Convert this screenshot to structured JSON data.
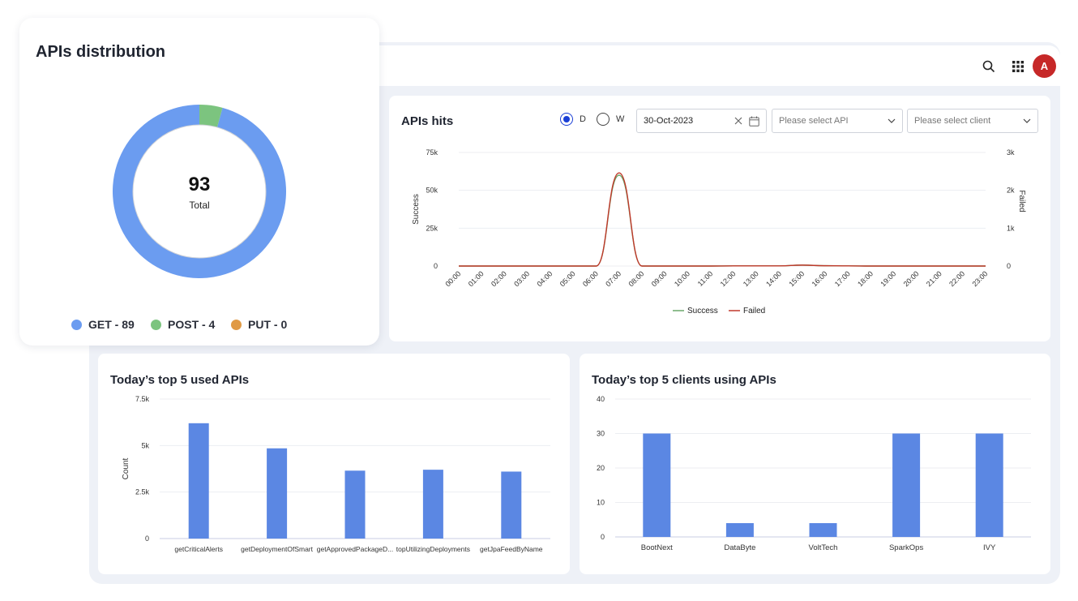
{
  "header": {
    "search_icon": "search-icon",
    "apps_icon": "apps-grid-icon",
    "avatar_initial": "A"
  },
  "distribution": {
    "title": "APIs distribution",
    "total_value": "93",
    "total_label": "Total",
    "legend": [
      {
        "label": "GET - 89",
        "color": "#6b9cf0"
      },
      {
        "label": "POST - 4",
        "color": "#7cc47f"
      },
      {
        "label": "PUT - 0",
        "color": "#e09a45"
      }
    ]
  },
  "hits": {
    "title": "APIs hits",
    "radio_d": "D",
    "radio_w": "W",
    "date_value": "30-Oct-2023",
    "api_placeholder": "Please select API",
    "client_placeholder": "Please select client"
  },
  "top_apis": {
    "title": "Today’s top 5 used APIs"
  },
  "top_clients": {
    "title": "Today’s top 5 clients using APIs"
  },
  "chart_data": [
    {
      "type": "pie",
      "categories": [
        "GET",
        "POST",
        "PUT"
      ],
      "values": [
        89,
        4,
        0
      ],
      "colors": [
        "#6b9cf0",
        "#7cc47f",
        "#e09a45"
      ]
    },
    {
      "type": "line",
      "title": "APIs hits",
      "x": [
        "00:00",
        "01:00",
        "02:00",
        "03:00",
        "04:00",
        "05:00",
        "06:00",
        "07:00",
        "08:00",
        "09:00",
        "10:00",
        "11:00",
        "12:00",
        "13:00",
        "14:00",
        "15:00",
        "16:00",
        "17:00",
        "18:00",
        "19:00",
        "20:00",
        "21:00",
        "22:00",
        "23:00"
      ],
      "ylabel": "Success",
      "y2label": "Failed",
      "ylim": [
        0,
        75000
      ],
      "y2lim": [
        0,
        3000
      ],
      "yticks": [
        "0",
        "25k",
        "50k",
        "75k"
      ],
      "y2ticks": [
        "0",
        "1k",
        "2k",
        "3k"
      ],
      "series": [
        {
          "name": "Success",
          "color": "#6aa86a",
          "axis": "left",
          "values": [
            0,
            0,
            0,
            0,
            0,
            0,
            0,
            60000,
            0,
            0,
            0,
            0,
            100,
            100,
            100,
            600,
            200,
            100,
            0,
            0,
            0,
            0,
            0,
            0
          ]
        },
        {
          "name": "Failed",
          "color": "#c0392b",
          "axis": "right",
          "values": [
            0,
            0,
            0,
            0,
            0,
            0,
            0,
            2460,
            0,
            0,
            0,
            0,
            4,
            4,
            4,
            24,
            8,
            4,
            0,
            0,
            0,
            0,
            0,
            0
          ]
        }
      ],
      "legend": "bottom-center"
    },
    {
      "type": "bar",
      "title": "Today’s top 5 used APIs",
      "categories": [
        "getCriticalAlerts",
        "getDeploymentOfSmart",
        "getApprovedPackageD...",
        "topUtilizingDeployments",
        "getJpaFeedByName"
      ],
      "values": [
        6200,
        4850,
        3650,
        3700,
        3600
      ],
      "ylabel": "Count",
      "ylim": [
        0,
        7500
      ],
      "yticks": [
        "0",
        "2.5k",
        "5k",
        "7.5k"
      ],
      "color": "#5b87e3"
    },
    {
      "type": "bar",
      "title": "Today’s top 5 clients using APIs",
      "categories": [
        "BootNext",
        "DataByte",
        "VoltTech",
        "SparkOps",
        "IVY"
      ],
      "values": [
        30,
        4,
        4,
        30,
        30
      ],
      "ylim": [
        0,
        40
      ],
      "yticks": [
        "0",
        "10",
        "20",
        "30",
        "40"
      ],
      "color": "#5b87e3"
    }
  ]
}
